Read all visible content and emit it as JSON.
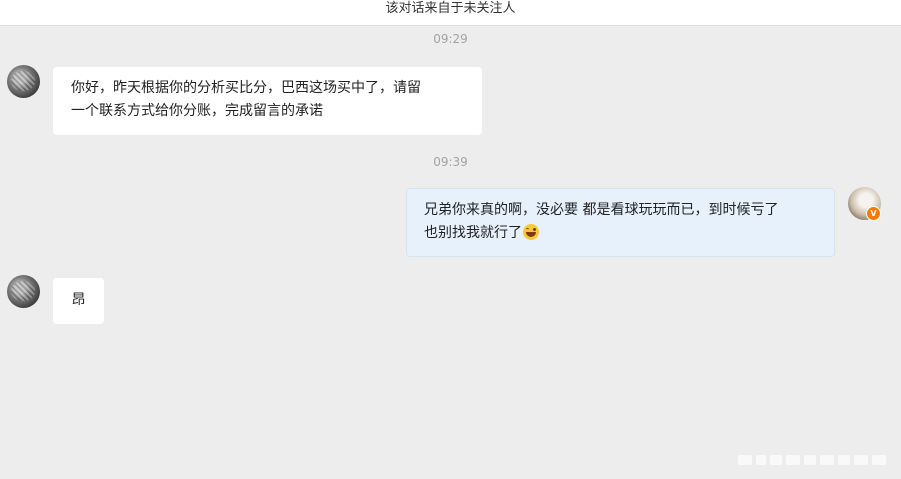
{
  "header": {
    "notice": "该对话来自于未关注人"
  },
  "messages": [
    {
      "timestamp": "09:29",
      "side": "left",
      "avatar_icon": "avatar-leopard-icon",
      "lines": [
        "你好，昨天根据你的分析买比分，巴西这场买中了，请留",
        "一个联系方式给你分账，完成留言的承诺"
      ]
    },
    {
      "timestamp": "09:39",
      "side": "right",
      "avatar_icon": "avatar-user-icon",
      "badge": "V",
      "lines": [
        "兄弟你来真的啊，没必要 都是看球玩玩而已，到时候亏了",
        "也别找我就行了"
      ],
      "emoji": "laughing-tears-emoji"
    },
    {
      "timestamp": "",
      "side": "left",
      "avatar_icon": "avatar-leopard-icon",
      "lines": [
        "昂"
      ]
    }
  ],
  "colors": {
    "background": "#ededed",
    "left_bubble": "#ffffff",
    "right_bubble": "#e6f1fc",
    "timestamp": "#a3a3a3",
    "badge": "#f47a00"
  }
}
